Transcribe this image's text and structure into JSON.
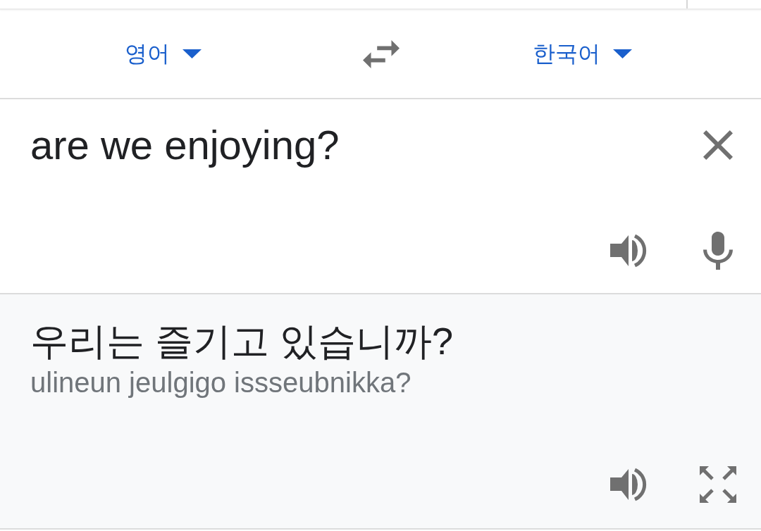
{
  "language_bar": {
    "source_language": "영어",
    "target_language": "한국어"
  },
  "input": {
    "value": "are we enjoying?"
  },
  "output": {
    "translation": "우리는 즐기고 있습니까?",
    "romanization": "ulineun jeulgigo issseubnikka?"
  }
}
